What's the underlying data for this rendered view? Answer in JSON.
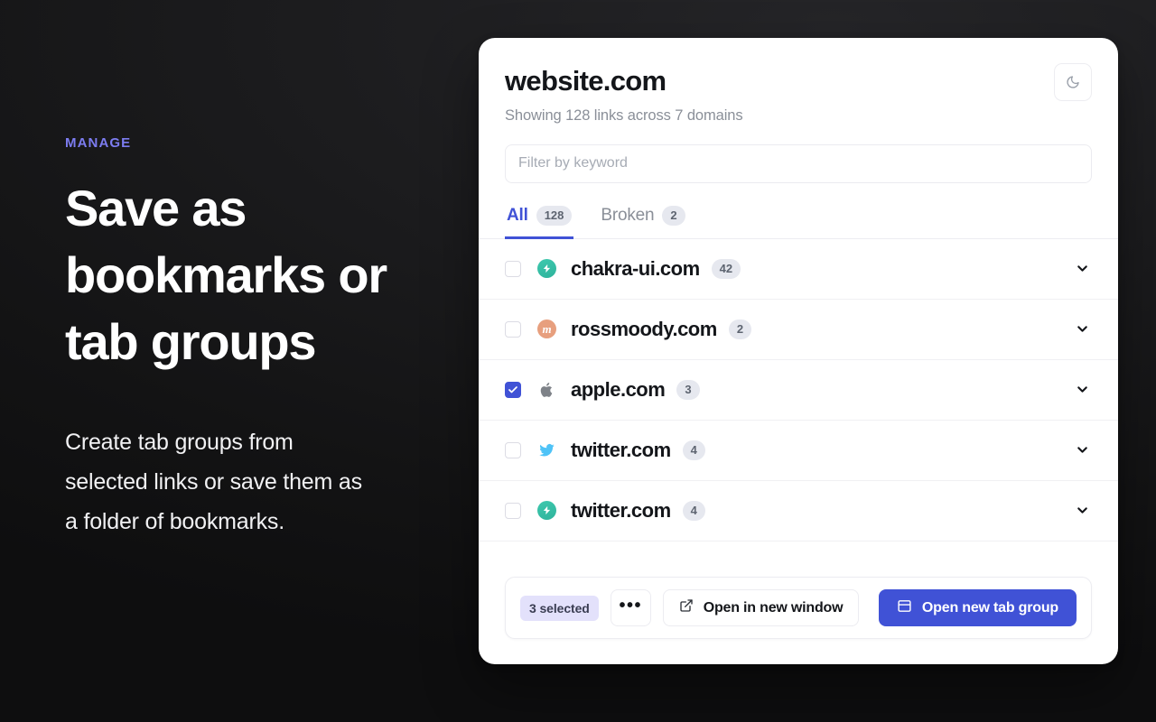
{
  "theme": {
    "accent": "#4052d6",
    "eyebrow_color": "#7c7cf0",
    "page_background": "#131314",
    "card_background": "#ffffff",
    "muted_text": "#8a8f98",
    "pill_background": "#e6e8ef",
    "selected_badge_background": "#e3e1fb"
  },
  "left_panel": {
    "eyebrow": "MANAGE",
    "headline": "Save as bookmarks or tab groups",
    "subcopy": "Create tab groups from selected links or save them as a folder of bookmarks."
  },
  "card": {
    "title": "website.com",
    "subtitle": "Showing 128 links across 7 domains",
    "theme_toggle": {
      "icon": "moon-icon",
      "label": ""
    },
    "filter": {
      "placeholder": "Filter by keyword",
      "value": ""
    },
    "tabs": [
      {
        "label": "All",
        "count": "128",
        "active": true
      },
      {
        "label": "Broken",
        "count": "2",
        "active": false
      }
    ],
    "rows": [
      {
        "domain": "chakra-ui.com",
        "count": "42",
        "checked": false,
        "icon": "chakra-ui-favicon",
        "chevron": "chevron-down-icon"
      },
      {
        "domain": "rossmoody.com",
        "count": "2",
        "checked": false,
        "icon": "rossmoody-favicon",
        "chevron": "chevron-down-icon"
      },
      {
        "domain": "apple.com",
        "count": "3",
        "checked": true,
        "icon": "apple-favicon",
        "chevron": "chevron-down-icon"
      },
      {
        "domain": "twitter.com",
        "count": "4",
        "checked": false,
        "icon": "twitter-favicon",
        "chevron": "chevron-down-icon"
      },
      {
        "domain": "twitter.com",
        "count": "4",
        "checked": false,
        "icon": "chakra-ui-favicon",
        "chevron": "chevron-down-icon"
      }
    ],
    "action_bar": {
      "selected_label": "3 selected",
      "more_label": "•••",
      "open_window_label": "Open in new window",
      "open_tab_group_label": "Open new tab group"
    }
  }
}
